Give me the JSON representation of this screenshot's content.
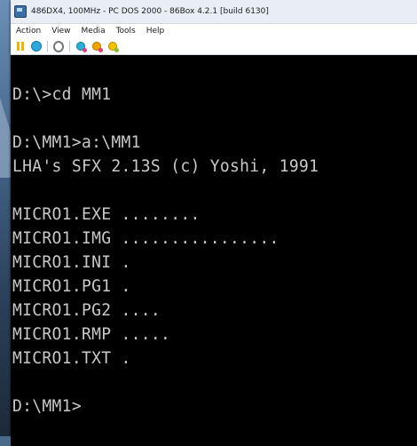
{
  "window": {
    "title": "486DX4, 100MHz - PC DOS 2000 - 86Box 4.2.1 [build 6130]"
  },
  "menu": {
    "items": [
      "Action",
      "View",
      "Media",
      "Tools",
      "Help"
    ]
  },
  "toolbar": {
    "icons": [
      "pause-icon",
      "reset-icon",
      "power-icon",
      "settings-icon-1",
      "settings-icon-2",
      "settings-icon-3"
    ]
  },
  "console": {
    "lines": [
      "D:\\>cd MM1",
      "",
      "D:\\MM1>a:\\MM1",
      "LHA's SFX 2.13S (c) Yoshi, 1991",
      "",
      "MICRO1.EXE ........",
      "MICRO1.IMG ................",
      "MICRO1.INI .",
      "MICRO1.PG1 .",
      "MICRO1.PG2 ....",
      "MICRO1.RMP .....",
      "MICRO1.TXT .",
      "",
      "D:\\MM1>"
    ]
  }
}
